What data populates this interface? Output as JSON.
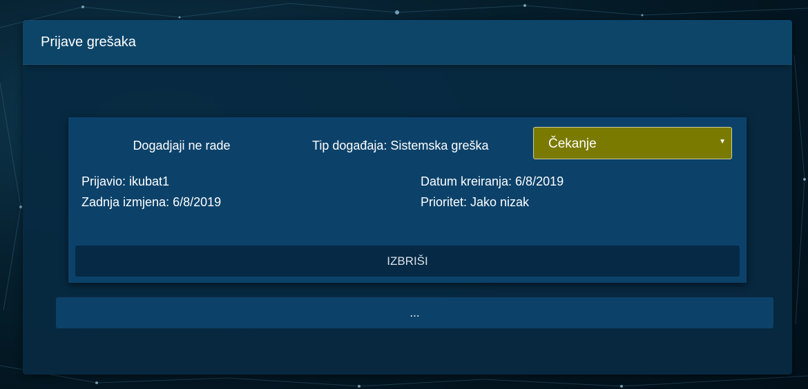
{
  "panel": {
    "title": "Prijave grešaka"
  },
  "report": {
    "name": "Dogadjaji ne rade",
    "type_label": "Tip događaja: Sistemska greška",
    "status": {
      "selected": "Čekanje",
      "color": "#7a7a00"
    },
    "reported_by": "Prijavio: ikubat1",
    "last_modified": "Zadnja izmjena: 6/8/2019",
    "created": "Datum kreiranja: 6/8/2019",
    "priority": "Prioritet: Jako nizak",
    "delete_label": "IZBRIŠI"
  },
  "load_more_label": "...",
  "colors": {
    "panel_header": "#0d4569",
    "card": "#0c426a",
    "delete_button": "#062945"
  }
}
